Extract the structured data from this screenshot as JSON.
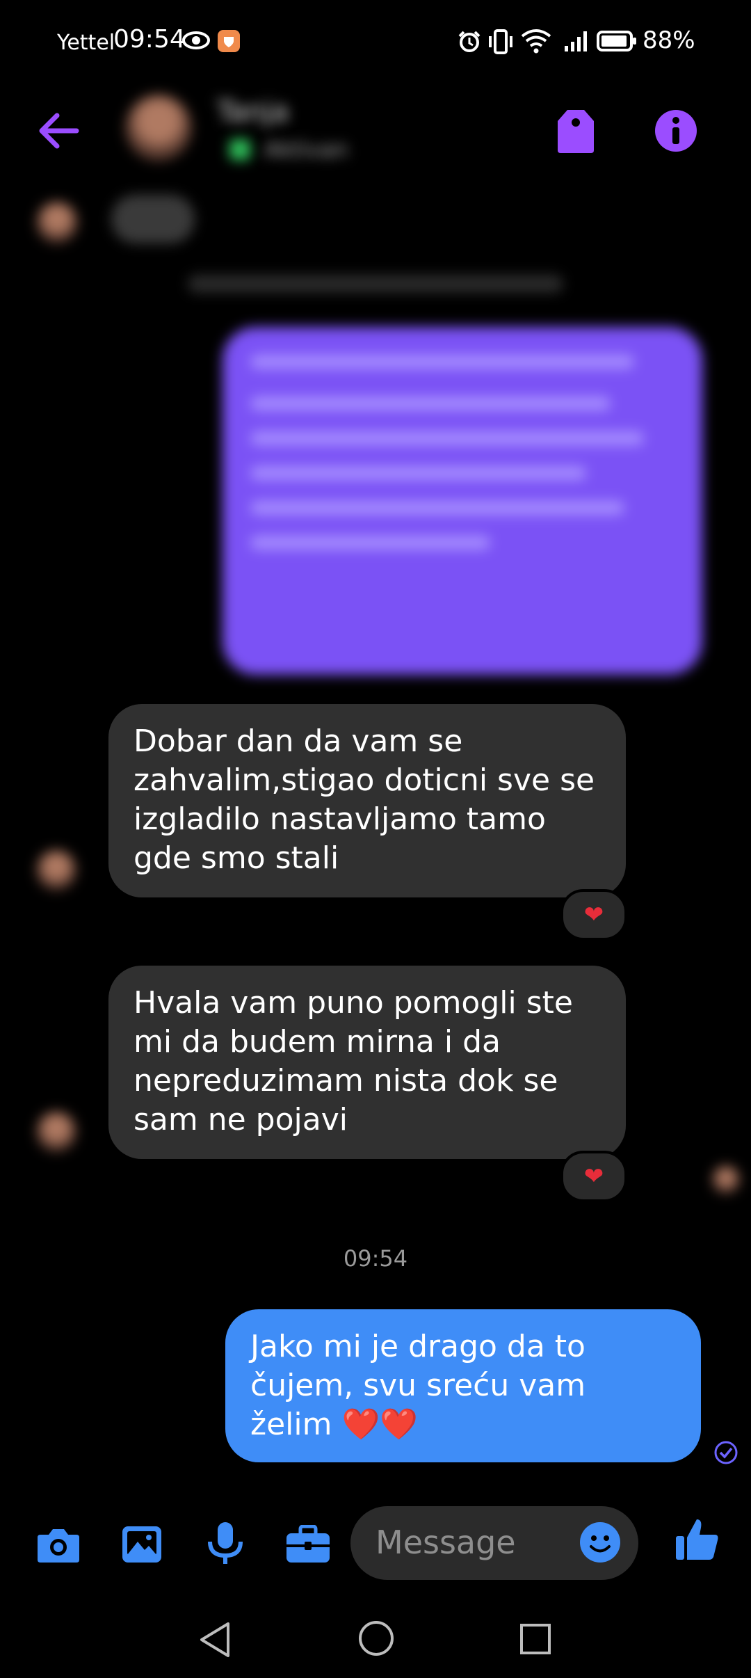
{
  "status_bar": {
    "carrier": "Yettel",
    "time": "09:54",
    "battery": "88%"
  },
  "header": {
    "back_icon": "arrow-left-icon",
    "contact_name": "Tanja",
    "contact_status": "Aktivan",
    "actions": [
      "tag-icon",
      "info-icon"
    ],
    "accent": "#9b4dff"
  },
  "messages": [
    {
      "id": "m1",
      "direction": "incoming",
      "text": "Dobar dan da vam se zahvalim,stigao doticni sve se izgladilo nastavljamo tamo gde smo stali",
      "reaction": "❤"
    },
    {
      "id": "m2",
      "direction": "incoming",
      "text": "Hvala vam puno pomogli ste mi da budem mirna i da nepreduzimam nista dok se sam ne pojavi",
      "reaction": "❤"
    },
    {
      "id": "ts1",
      "type": "timestamp",
      "text": "09:54"
    },
    {
      "id": "m3",
      "direction": "outgoing",
      "text": "Jako mi je drago da to čujem, svu sreću vam želim ❤️❤️",
      "status": "sent-check-icon"
    }
  ],
  "composer": {
    "placeholder": "Message",
    "buttons": [
      "camera-icon",
      "gallery-icon",
      "microphone-icon",
      "briefcase-icon"
    ],
    "emoji_icon": "emoji-icon",
    "like_icon": "thumbs-up-icon",
    "accent": "#3f8df7"
  },
  "nav_bar": {
    "buttons": [
      "back-triangle-icon",
      "home-circle-icon",
      "recents-square-icon"
    ]
  }
}
